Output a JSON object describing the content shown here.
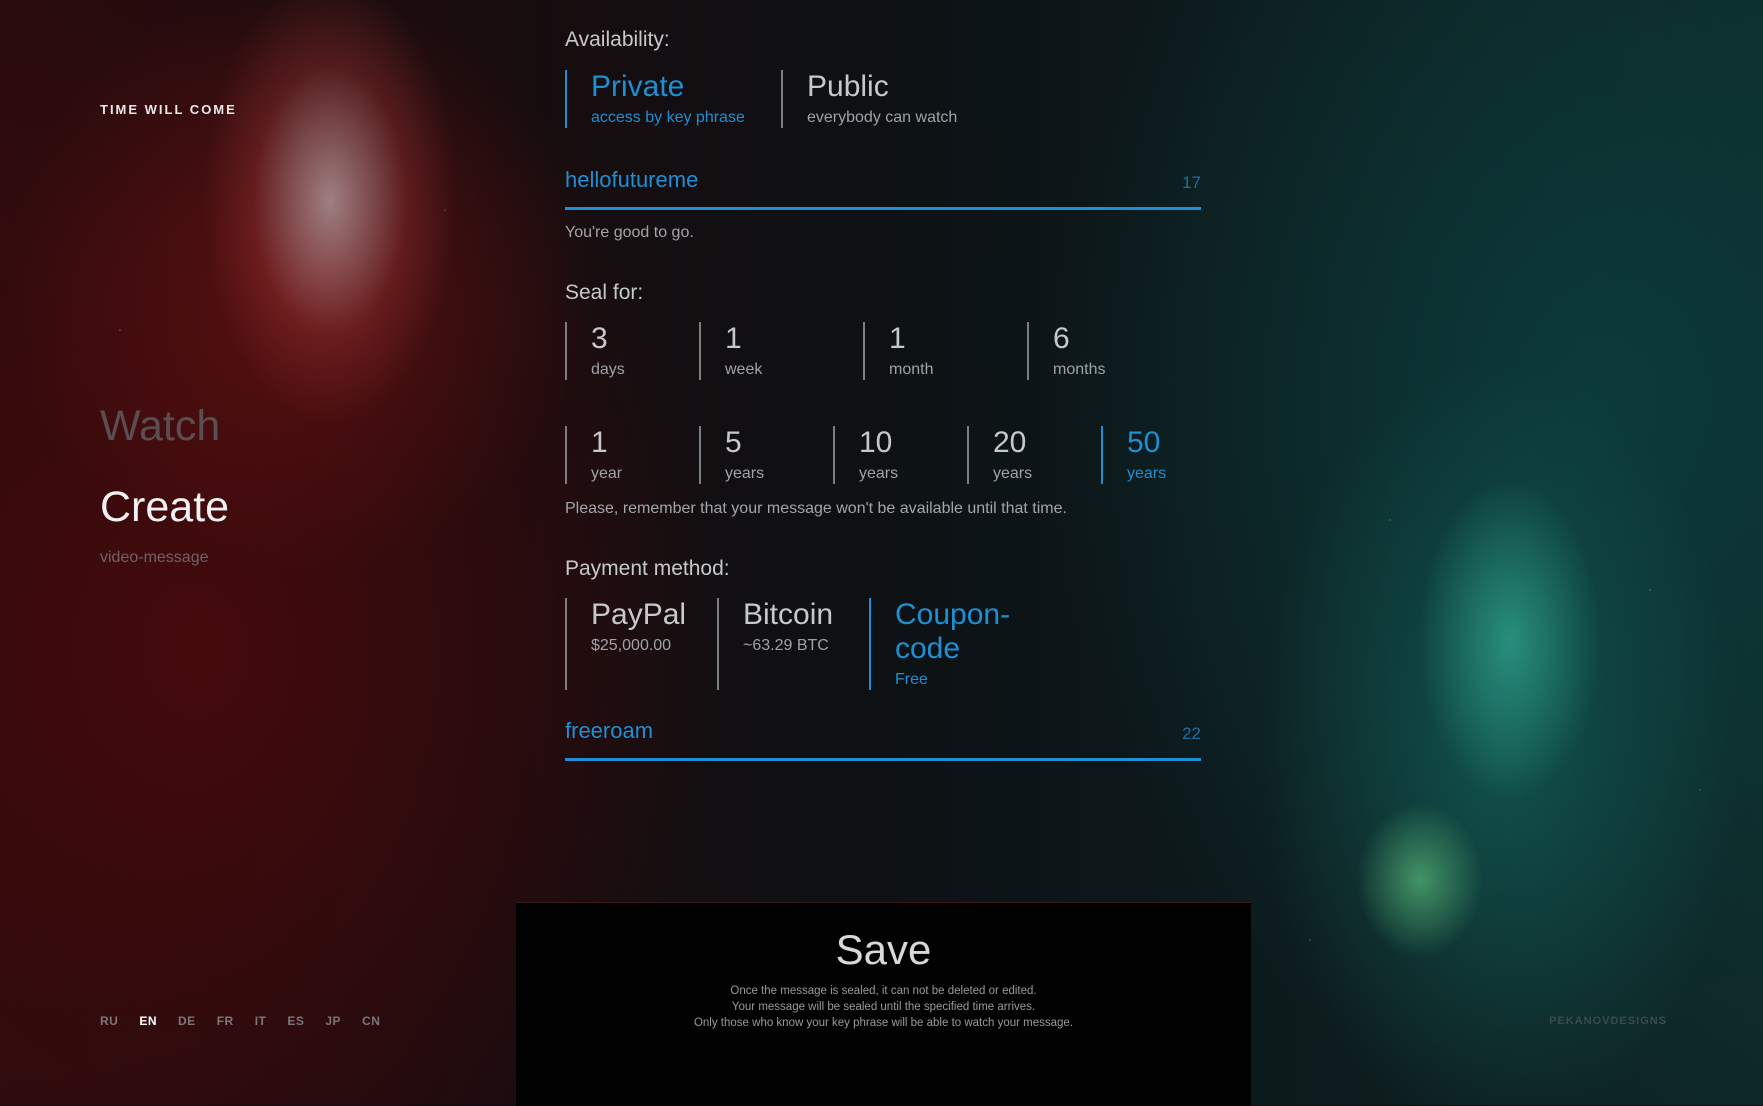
{
  "app": {
    "brand": "TIME WILL COME"
  },
  "nav": {
    "watch": "Watch",
    "create": "Create",
    "create_sub": "video-message"
  },
  "languages": [
    {
      "code": "RU",
      "active": false
    },
    {
      "code": "EN",
      "active": true
    },
    {
      "code": "DE",
      "active": false
    },
    {
      "code": "FR",
      "active": false
    },
    {
      "code": "IT",
      "active": false
    },
    {
      "code": "ES",
      "active": false
    },
    {
      "code": "JP",
      "active": false
    },
    {
      "code": "CN",
      "active": false
    }
  ],
  "credit": "PEKANOVDESIGNS",
  "availability": {
    "label": "Availability:",
    "options": [
      {
        "title": "Private",
        "sub": "access by key phrase",
        "selected": true
      },
      {
        "title": "Public",
        "sub": "everybody can watch",
        "selected": false
      }
    ],
    "key_phrase": {
      "value": "hellofutureme",
      "count": "17"
    },
    "status": "You're good to go."
  },
  "seal": {
    "label": "Seal for:",
    "row1": [
      {
        "num": "3",
        "unit": "days",
        "selected": false
      },
      {
        "num": "1",
        "unit": "week",
        "selected": false
      },
      {
        "num": "1",
        "unit": "month",
        "selected": false
      },
      {
        "num": "6",
        "unit": "months",
        "selected": false
      }
    ],
    "row2": [
      {
        "num": "1",
        "unit": "year",
        "selected": false
      },
      {
        "num": "5",
        "unit": "years",
        "selected": false
      },
      {
        "num": "10",
        "unit": "years",
        "selected": false
      },
      {
        "num": "20",
        "unit": "years",
        "selected": false
      },
      {
        "num": "50",
        "unit": "years",
        "selected": true
      }
    ],
    "note": "Please, remember that your message won't be available until that time."
  },
  "payment": {
    "label": "Payment method:",
    "options": [
      {
        "title": "PayPal",
        "sub": "$25,000.00",
        "selected": false
      },
      {
        "title": "Bitcoin",
        "sub": "~63.29 BTC",
        "selected": false
      },
      {
        "title": "Coupon-code",
        "sub": "Free",
        "selected": true
      }
    ],
    "coupon": {
      "value": "freeroam",
      "count": "22"
    }
  },
  "save": {
    "label": "Save",
    "lines": [
      "Once the message is sealed, it can not be deleted or edited.",
      "Your message will be sealed until the specified time arrives.",
      "Only those who know your key phrase will be able to watch your message."
    ]
  },
  "colors": {
    "accent": "#1e8fd4",
    "text": "#c6c9cc",
    "muted": "#7b7f83"
  }
}
